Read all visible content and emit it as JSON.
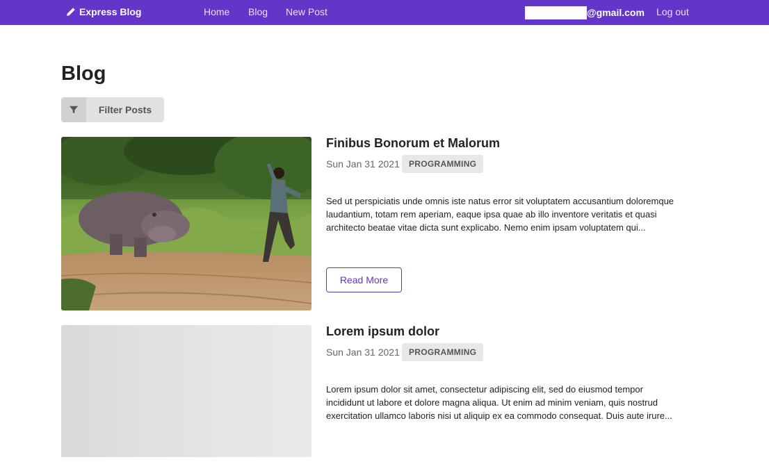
{
  "navbar": {
    "brand": "Express Blog",
    "links": [
      "Home",
      "Blog",
      "New Post"
    ],
    "user_email_visible": "@gmail.com",
    "logout": "Log out",
    "color": "#6435c9"
  },
  "page": {
    "title": "Blog",
    "filter_label": "Filter Posts"
  },
  "posts": [
    {
      "title": "Finibus Bonorum et Malorum",
      "date": "Sun Jan 31 2021",
      "tag": "PROGRAMMING",
      "excerpt": "Sed ut perspiciatis unde omnis iste natus error sit voluptatem accusantium doloremque laudantium, totam rem aperiam, eaque ipsa quae ab illo inventore veritatis et quasi architecto beatae vitae dicta sunt explicabo. Nemo enim ipsam voluptatem qui...",
      "read_more": "Read More",
      "image": "hippo-chasing-man-photo"
    },
    {
      "title": "Lorem ipsum dolor",
      "date": "Sun Jan 31 2021",
      "tag": "PROGRAMMING",
      "excerpt": "Lorem ipsum dolor sit amet, consectetur adipiscing elit, sed do eiusmod tempor incididunt ut labore et dolore magna aliqua. Ut enim ad minim veniam, quis nostrud exercitation ullamco laboris nisi ut aliquip ex ea commodo consequat. Duis aute irure...",
      "image": "placeholder-image"
    }
  ],
  "icons": {
    "brand": "pencil-icon",
    "filter": "filter-icon"
  }
}
